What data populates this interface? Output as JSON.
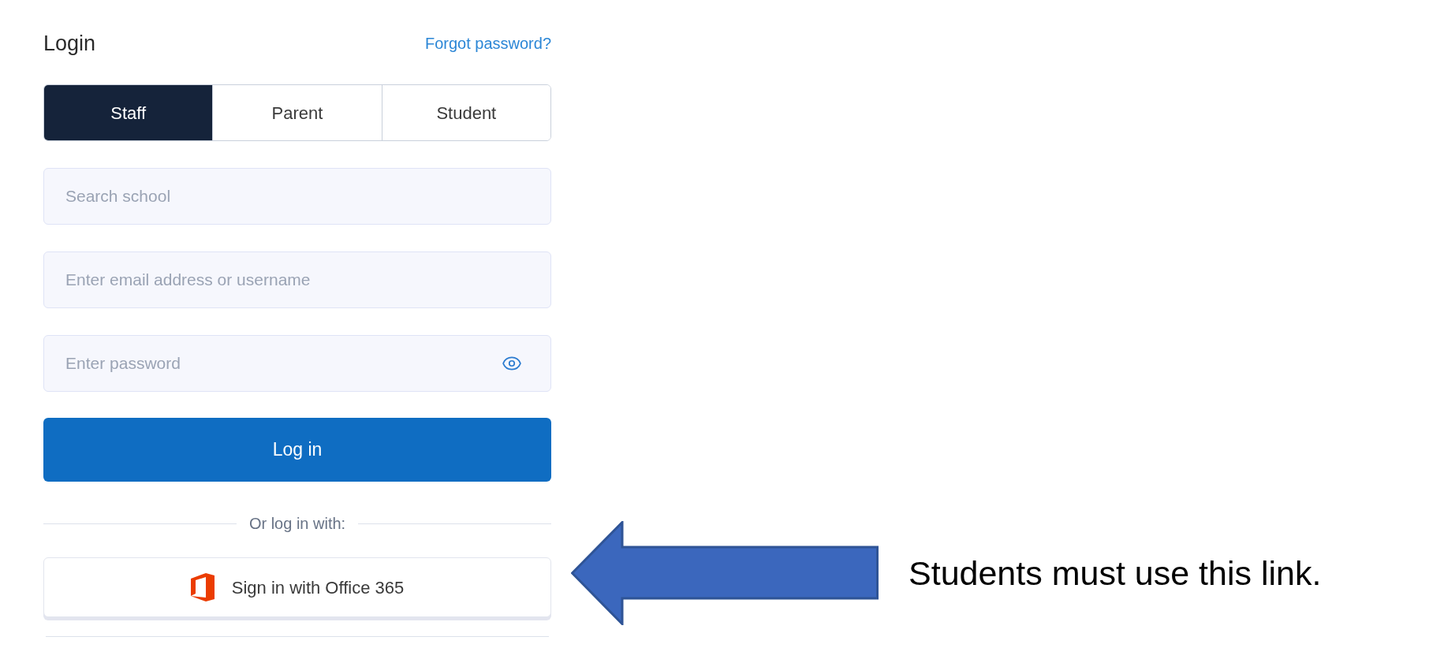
{
  "login": {
    "title": "Login",
    "forgot_link": "Forgot password?",
    "tabs": [
      {
        "label": "Staff",
        "selected": true
      },
      {
        "label": "Parent",
        "selected": false
      },
      {
        "label": "Student",
        "selected": false
      }
    ],
    "fields": [
      {
        "kind": "text",
        "placeholder": "Search school"
      },
      {
        "kind": "text",
        "placeholder": "Enter email address or username"
      },
      {
        "kind": "password",
        "placeholder": "Enter password"
      }
    ],
    "submit": "Log in",
    "divider": "Or log in with:",
    "sso_button": "Sign in with Office 365"
  },
  "annotation": {
    "text": "Students must use this link."
  }
}
